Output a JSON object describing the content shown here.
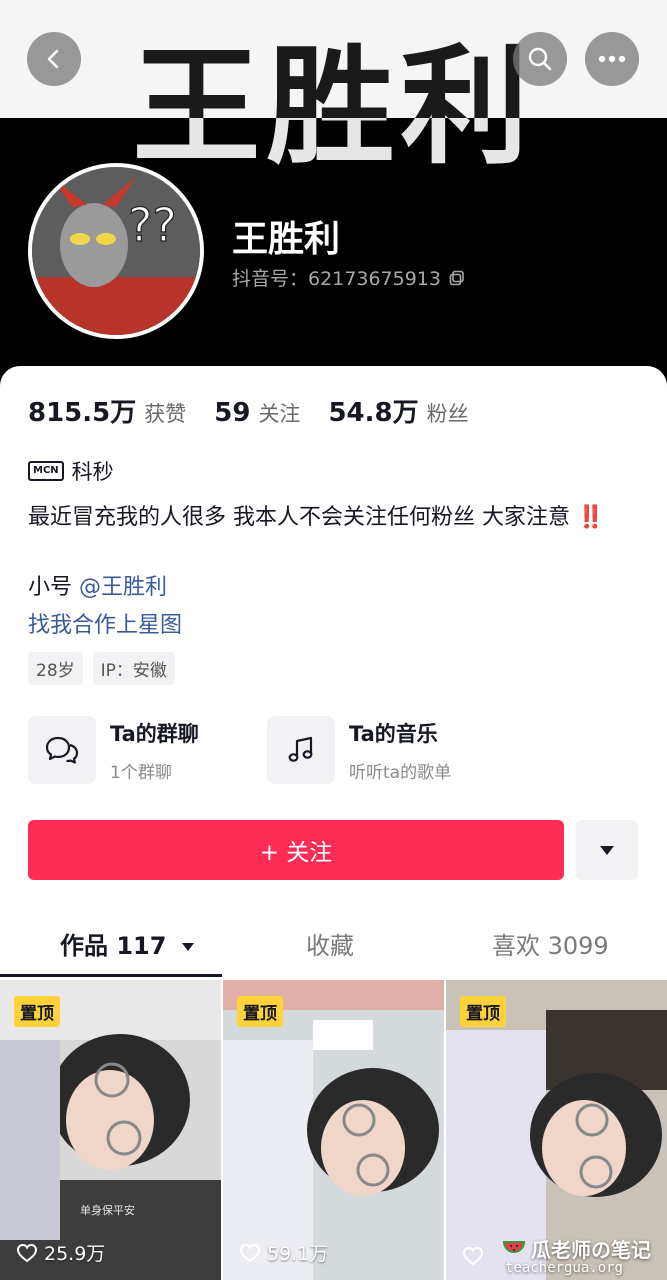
{
  "banner": {
    "text": "王胜利"
  },
  "profile": {
    "name": "王胜利",
    "douyin_id_label": "抖音号：62173675913"
  },
  "stats": [
    {
      "value": "815.5万",
      "label": "获赞"
    },
    {
      "value": "59",
      "label": "关注"
    },
    {
      "value": "54.8万",
      "label": "粉丝"
    }
  ],
  "mcn": {
    "badge": "MCN",
    "name": "科秒"
  },
  "bio": {
    "text": "最近冒充我的人很多 我本人不会关注任何粉丝 大家注意",
    "emphasis": "‼️",
    "alt_account_prefix": "小号",
    "alt_account_mention": "@王胜利",
    "link": "找我合作上星图"
  },
  "tags": [
    "28岁",
    "IP：安徽"
  ],
  "features": [
    {
      "title": "Ta的群聊",
      "subtitle": "1个群聊",
      "icon": "chat-icon"
    },
    {
      "title": "Ta的音乐",
      "subtitle": "听听ta的歌单",
      "icon": "music-note-icon"
    }
  ],
  "actions": {
    "follow_label": "+ 关注"
  },
  "tabs": [
    {
      "label": "作品 117",
      "active": true
    },
    {
      "label": "收藏",
      "active": false
    },
    {
      "label": "喜欢 3099",
      "active": false
    }
  ],
  "videos": [
    {
      "pinned_label": "置顶",
      "likes": "25.9万",
      "caption": "单身保平安"
    },
    {
      "pinned_label": "置顶",
      "likes": "59.1万"
    },
    {
      "pinned_label": "置顶",
      "likes": ""
    }
  ],
  "watermark": {
    "text": "瓜老师の笔记",
    "url": "teachergua.org"
  },
  "colors": {
    "accent": "#fe2c55",
    "link": "#3a5a9a",
    "pin": "#ffd23a"
  }
}
